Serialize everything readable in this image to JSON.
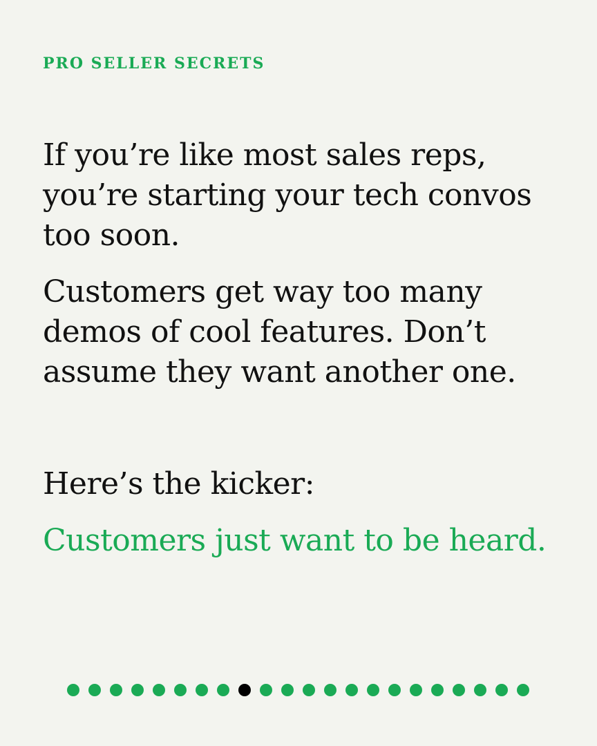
{
  "eyebrow": "PRO SELLER SECRETS",
  "paragraphs": {
    "intro": "If you’re like most sales reps, you’re starting your tech convos too soon.",
    "demos": "Customers get way too many demos of cool features. Don’t assume they want another one.",
    "kicker_label": "Here’s the kicker:",
    "kicker_highlight": "Customers just want to be heard."
  },
  "pagination": {
    "total": 22,
    "current": 9
  },
  "colors": {
    "background": "#f3f4ef",
    "text": "#111111",
    "accent": "#1aaa55",
    "active_dot": "#000000"
  }
}
